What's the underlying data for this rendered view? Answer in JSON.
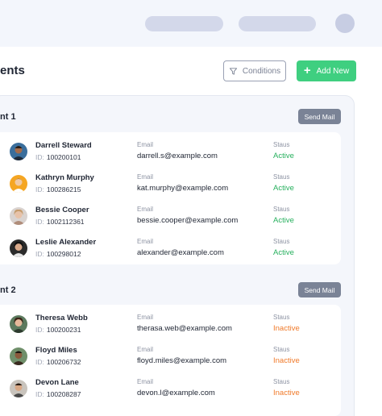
{
  "header": {
    "page_title": "ents"
  },
  "toolbar": {
    "conditions_label": "Conditions",
    "add_label": "Add New"
  },
  "groups": [
    {
      "title": "nt 1",
      "send_label": "Send Mail",
      "rows": [
        {
          "name": "Darrell Steward",
          "id_label": "ID:",
          "id": "100200101",
          "email_label": "Email",
          "email": "darrell.s@example.com",
          "status_label": "Staus",
          "status": "Active"
        },
        {
          "name": "Kathryn Murphy",
          "id_label": "ID:",
          "id": "100286215",
          "email_label": "Email",
          "email": "kat.murphy@example.com",
          "status_label": "Staus",
          "status": "Active"
        },
        {
          "name": "Bessie Cooper",
          "id_label": "ID:",
          "id": "1002112361",
          "email_label": "Email",
          "email": "bessie.cooper@example.com",
          "status_label": "Staus",
          "status": "Active"
        },
        {
          "name": "Leslie Alexander",
          "id_label": "ID:",
          "id": "100298012",
          "email_label": "Email",
          "email": "alexander@example.com",
          "status_label": "Staus",
          "status": "Active"
        }
      ]
    },
    {
      "title": "nt 2",
      "send_label": "Send Mail",
      "rows": [
        {
          "name": "Theresa Webb",
          "id_label": "ID:",
          "id": "100200231",
          "email_label": "Email",
          "email": "therasa.web@example.com",
          "status_label": "Staus",
          "status": "Inactive"
        },
        {
          "name": "Floyd Miles",
          "id_label": "ID:",
          "id": "100206732",
          "email_label": "Email",
          "email": "floyd.miles@example.com",
          "status_label": "Staus",
          "status": "Inactive"
        },
        {
          "name": "Devon Lane",
          "id_label": "ID:",
          "id": "100208287",
          "email_label": "Email",
          "email": "devon.l@example.com",
          "status_label": "Staus",
          "status": "Inactive"
        }
      ]
    }
  ],
  "colors": {
    "accent_green": "#3fcf80",
    "active": "#27b05e",
    "inactive": "#f07a2a",
    "send_mail": "#7a8396"
  },
  "icons": {
    "conditions": "filter-icon",
    "add": "plus-icon",
    "avatar": "user-avatar-icon"
  }
}
